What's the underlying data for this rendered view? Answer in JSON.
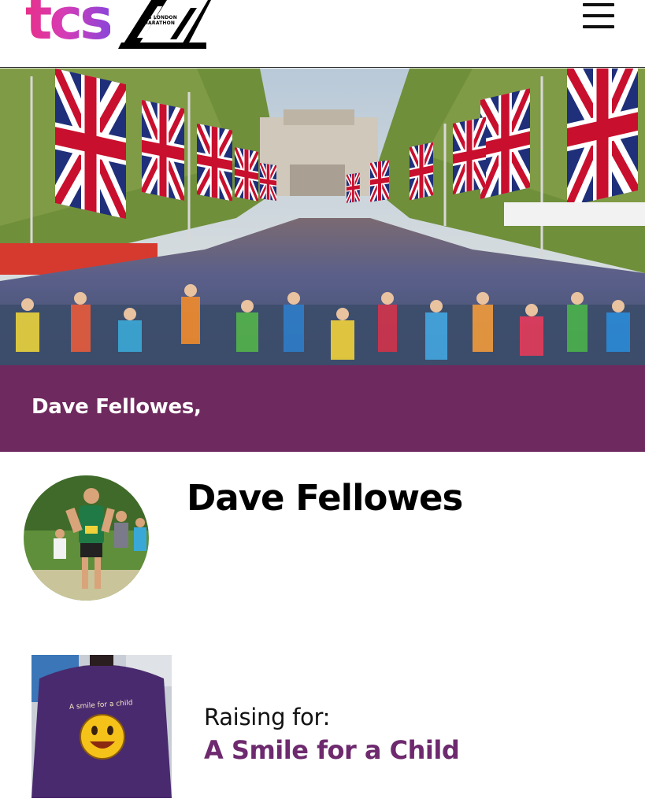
{
  "header": {
    "brand_logo_text": "tcs",
    "marathon_logo_text": "TCS LONDON MARATHON",
    "menu_icon": "hamburger-menu-icon"
  },
  "hero": {
    "image_description_icon": "hero-photo"
  },
  "band": {
    "title": "Dave Fellowes,"
  },
  "profile": {
    "name": "Dave Fellowes"
  },
  "charity": {
    "raising_label": "Raising for:",
    "name": "A Smile for a Child",
    "shirt_text": "A smile for a child"
  },
  "colors": {
    "brand_purple": "#6e2a5e",
    "link_purple": "#6e2a6e",
    "tcs_gradient_start": "#e8308a",
    "tcs_gradient_end": "#8b45d9"
  }
}
